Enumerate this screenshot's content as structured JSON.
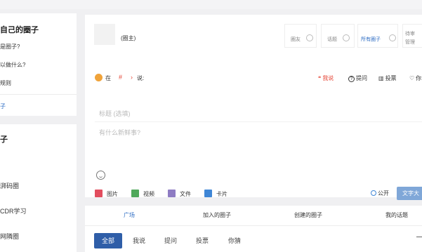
{
  "sidebar": {
    "card_title": "自己的圈子",
    "links": [
      "是圈子?",
      "以做什么?",
      "规则"
    ],
    "active_link": "子",
    "section_title": "子",
    "items": [
      "湃码圈",
      "CDR学习",
      "网隣圈"
    ]
  },
  "header": {
    "owner_label": "(圈主)",
    "stats": [
      {
        "label": "圈友"
      },
      {
        "label": "话题"
      },
      {
        "label": "所有圈子"
      },
      {
        "label": "待审",
        "sub": "管理"
      }
    ]
  },
  "composer": {
    "in_label": "在",
    "hash": "#",
    "arrow": "›",
    "say_label": "说:",
    "modes": [
      {
        "icon": "quote-icon",
        "glyph": "❝",
        "label": "我说"
      },
      {
        "icon": "question-icon",
        "glyph": "?",
        "label": "提问"
      },
      {
        "icon": "vote-icon",
        "glyph": "▥",
        "label": "投票"
      },
      {
        "icon": "heart-icon",
        "glyph": "♡",
        "label": "你"
      }
    ],
    "title_placeholder": "标题 (选填)",
    "content_placeholder": "有什么新鲜事?",
    "attachments": [
      {
        "icon": "image-icon",
        "label": "图片",
        "color": "#e24d5e"
      },
      {
        "icon": "video-icon",
        "label": "视频",
        "color": "#4fa85b"
      },
      {
        "icon": "file-icon",
        "label": "文件",
        "color": "#8e7cc3"
      },
      {
        "icon": "card-icon",
        "label": "卡片",
        "color": "#3f86d6"
      }
    ],
    "visibility_label": "公开",
    "publish_label": "文字大"
  },
  "feed_tabs": {
    "tabs": [
      "广场",
      "加入的圈子",
      "创建的圈子",
      "我的话题"
    ],
    "active_tab": 0,
    "filters": [
      "全部",
      "我说",
      "提问",
      "投票",
      "你猜"
    ],
    "active_filter": 0
  },
  "colors": {
    "accent_blue": "#2f5ea8",
    "red": "#e64a3b"
  }
}
